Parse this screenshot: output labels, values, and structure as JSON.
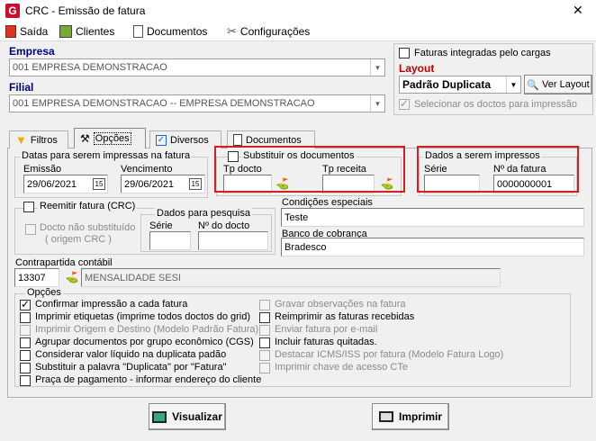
{
  "window": {
    "title": "CRC - Emissão de fatura",
    "close_label": "✕"
  },
  "menu": {
    "saida": "Saída",
    "clientes": "Clientes",
    "documentos": "Documentos",
    "configuracoes": "Configurações"
  },
  "empresa": {
    "label": "Empresa",
    "value": "001 EMPRESA DEMONSTRACAO"
  },
  "filial": {
    "label": "Filial",
    "value": "001 EMPRESA DEMONSTRACAO -- EMPRESA DEMONSTRACAO"
  },
  "right_panel": {
    "faturas_integradas": "Faturas integradas pelo cargas",
    "layout_label": "Layout",
    "layout_value": "Padrão Duplicata",
    "ver_layout": "Ver Layout",
    "selecionar": "Selecionar os doctos para impressão"
  },
  "tabs": {
    "filtros": "Filtros",
    "opcoes": "Opções",
    "diversos": "Diversos",
    "documentos": "Documentos"
  },
  "datas": {
    "legend": "Datas para serem impressas na fatura",
    "emissao_label": "Emissão",
    "emissao_value": "29/06/2021",
    "vencimento_label": "Vencimento",
    "vencimento_value": "29/06/2021",
    "cal_icon": "15"
  },
  "substituir": {
    "legend": "Substituir os documentos",
    "tp_docto": "Tp docto",
    "tp_receita": "Tp receita"
  },
  "dados_impressos": {
    "legend": "Dados a serem impressos",
    "serie_label": "Série",
    "serie_value": "",
    "nfatura_label": "Nº da fatura",
    "nfatura_value": "0000000001"
  },
  "reemitir": {
    "legend": "Reemitir fatura (CRC)",
    "docto_nao": "Docto não substituído",
    "origem": "( origem CRC )"
  },
  "pesquisa": {
    "legend": "Dados para pesquisa",
    "serie_label": "Série",
    "ndocto_label": "Nº do docto"
  },
  "condicoes": {
    "label": "Condições especiais",
    "value": "Teste"
  },
  "banco": {
    "label": "Banco de cobrança",
    "value": "Bradesco"
  },
  "contrapartida": {
    "label": "Contrapartida contábil",
    "code": "13307",
    "desc": "MENSALIDADE SESI"
  },
  "opcoes": {
    "legend": "Opções",
    "left": [
      {
        "label": "Confirmar impressão a cada fatura",
        "checked": true,
        "enabled": true
      },
      {
        "label": "Imprimir etiquetas (imprime todos doctos do grid)",
        "checked": false,
        "enabled": true
      },
      {
        "label": "Imprimir Origem e Destino (Modelo Padrão Fatura)",
        "checked": false,
        "enabled": false
      },
      {
        "label": "Agrupar documentos por grupo econômico (CGS)",
        "checked": false,
        "enabled": true
      },
      {
        "label": "Considerar valor líquido na duplicata padão",
        "checked": false,
        "enabled": true
      },
      {
        "label": "Substituir a palavra \"Duplicata\" por \"Fatura\"",
        "checked": false,
        "enabled": true
      },
      {
        "label": "Praça de pagamento - informar endereço do cliente",
        "checked": false,
        "enabled": true
      }
    ],
    "right": [
      {
        "label": "Gravar observações na fatura",
        "checked": false,
        "enabled": false
      },
      {
        "label": "Reimprimir as faturas recebidas",
        "checked": false,
        "enabled": true
      },
      {
        "label": "Enviar fatura por e-mail",
        "checked": false,
        "enabled": false
      },
      {
        "label": "Incluir faturas quitadas.",
        "checked": false,
        "enabled": true
      },
      {
        "label": "Destacar ICMS/ISS por fatura (Modelo Fatura Logo)",
        "checked": false,
        "enabled": false
      },
      {
        "label": "Imprimir chave de acesso CTe",
        "checked": false,
        "enabled": false
      }
    ]
  },
  "buttons": {
    "visualizar": "Visualizar",
    "imprimir": "Imprimir"
  }
}
